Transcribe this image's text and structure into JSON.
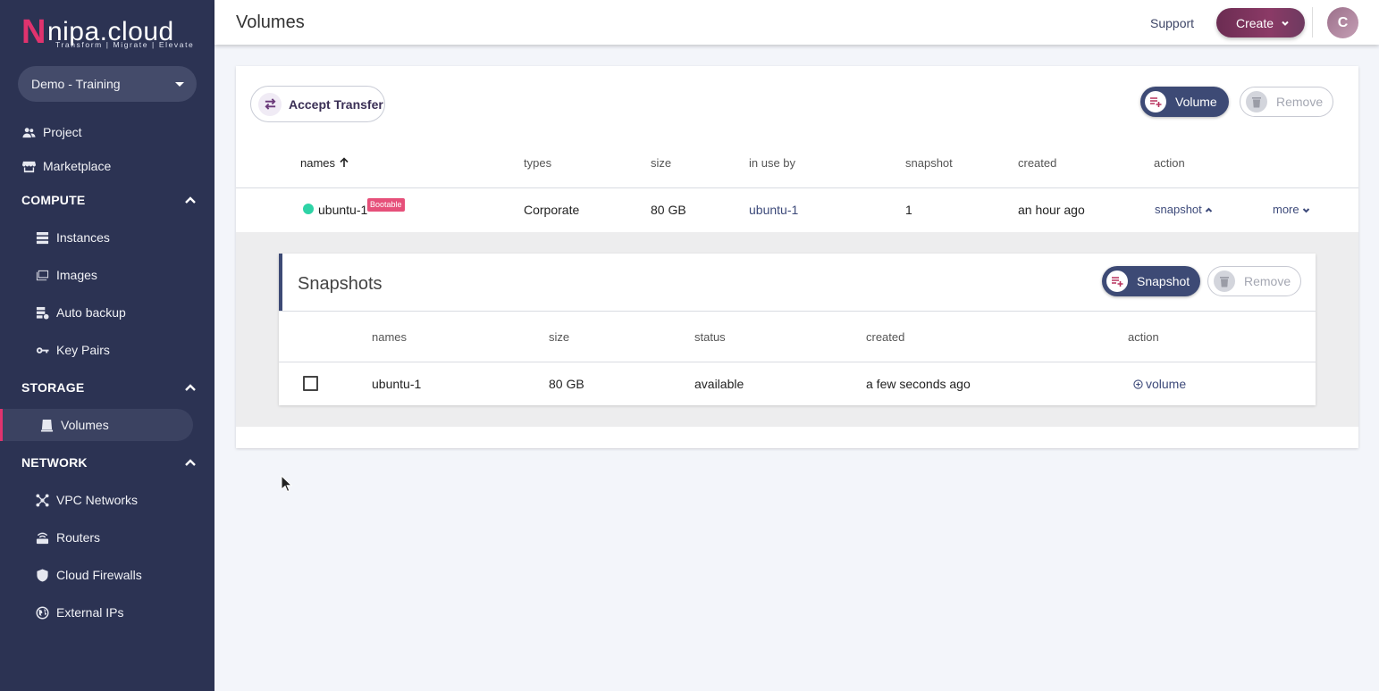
{
  "brand": {
    "logo_text": "nipa.cloud",
    "logo_initial": "N",
    "tagline": "Transform | Migrate | Elevate"
  },
  "project_selector": {
    "value": "Demo - Training"
  },
  "sidebar": {
    "top_items": [
      {
        "label": "Project",
        "icon": "people-icon"
      },
      {
        "label": "Marketplace",
        "icon": "store-icon"
      }
    ],
    "sections": {
      "compute": {
        "title": "COMPUTE",
        "items": [
          {
            "label": "Instances",
            "icon": "server-icon"
          },
          {
            "label": "Images",
            "icon": "images-icon"
          },
          {
            "label": "Auto backup",
            "icon": "backup-icon"
          },
          {
            "label": "Key Pairs",
            "icon": "key-icon"
          }
        ]
      },
      "storage": {
        "title": "STORAGE",
        "items": [
          {
            "label": "Volumes",
            "icon": "volume-icon",
            "active": true
          }
        ]
      },
      "network": {
        "title": "NETWORK",
        "items": [
          {
            "label": "VPC Networks",
            "icon": "network-icon"
          },
          {
            "label": "Routers",
            "icon": "router-icon"
          },
          {
            "label": "Cloud Firewalls",
            "icon": "shield-icon"
          },
          {
            "label": "External IPs",
            "icon": "globe-icon"
          }
        ]
      }
    }
  },
  "header": {
    "title": "Volumes",
    "support_label": "Support",
    "create_label": "Create",
    "avatar_initial": "C"
  },
  "volumes": {
    "accept_transfer_label": "Accept Transfer",
    "add_volume_label": "Volume",
    "remove_label": "Remove",
    "columns": {
      "names": "names",
      "types": "types",
      "size": "size",
      "in_use_by": "in use by",
      "snapshot": "snapshot",
      "created": "created",
      "action": "action"
    },
    "rows": [
      {
        "name": "ubuntu-1",
        "badge": "Bootable",
        "type": "Corporate",
        "size": "80 GB",
        "in_use_by": "ubuntu-1",
        "snapshot": "1",
        "created": "an hour ago",
        "action_snapshot": "snapshot",
        "action_more": "more"
      }
    ]
  },
  "snapshots": {
    "title": "Snapshots",
    "add_label": "Snapshot",
    "remove_label": "Remove",
    "columns": {
      "names": "names",
      "size": "size",
      "status": "status",
      "created": "created",
      "action": "action"
    },
    "rows": [
      {
        "name": "ubuntu-1",
        "size": "80 GB",
        "status": "available",
        "created": "a few seconds ago",
        "action": "volume"
      }
    ]
  },
  "colors": {
    "sidebar_bg": "#2c3353",
    "accent_pink": "#e0336e",
    "primary_navy": "#3d4a75",
    "status_green": "#2ed3a6",
    "badge_pink": "#e6507a"
  }
}
